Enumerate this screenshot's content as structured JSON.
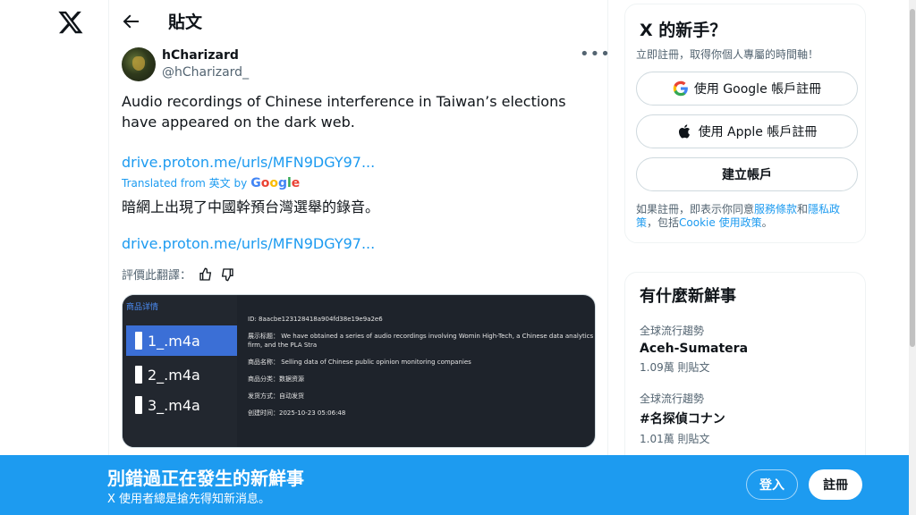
{
  "header": {
    "title": "貼文"
  },
  "author": {
    "name": "hCharizard",
    "handle": "@hCharizard_"
  },
  "tweet": {
    "text": "Audio recordings of Chinese interference in Taiwan’s elections have appeared on the dark web.",
    "link": "drive.proton.me/urls/MFN9DGY97...",
    "translated_prefix": "Translated from 英文 by",
    "translated_text": "暗網上出現了中國幹預台灣選舉的錄音。",
    "link2": "drive.proton.me/urls/MFN9DGY97...",
    "rate_label": "評價此翻譯："
  },
  "media": {
    "sidebar_title": "商品详情",
    "files": [
      "1_.m4a",
      "2_.m4a",
      "3_.m4a"
    ],
    "info": [
      "ID: 8aacbe123128418a904fd38e19e9a2e6",
      "展示标题：  We have obtained a series of audio recordings involving Womin High-Tech, a Chinese data analytics firm, and the PLA Stra",
      "商品名称：  Selling data of Chinese public opinion monitoring companies",
      "商品分类：数据资源",
      "发货方式：自动发货",
      "创建时间：2025-10-23 05:06:48"
    ]
  },
  "signup_card": {
    "title": "X 的新手？",
    "subtitle": "立即註冊，取得你個人專屬的時間軸！",
    "google_btn": "使用 Google 帳戶註冊",
    "apple_btn": "使用 Apple 帳戶註冊",
    "create_btn": "建立帳戶",
    "terms_pre": "如果註冊，即表示你同意",
    "terms_link1": "服務條款",
    "terms_and": "和",
    "terms_link2": "隱私政策",
    "terms_mid": "，包括",
    "terms_link3": "Cookie 使用政策",
    "terms_end": "。"
  },
  "trends": {
    "title": "有什麼新鮮事",
    "items": [
      {
        "category": "全球流行趨勢",
        "name": "Aceh-Sumatera",
        "count": "1.09萬 則貼文"
      },
      {
        "category": "全球流行趨勢",
        "name": "#名探偵コナン",
        "count": "1.01萬 則貼文"
      }
    ]
  },
  "bottom_bar": {
    "title": "別錯過正在發生的新鮮事",
    "subtitle": "X 使用者總是搶先得知新消息。",
    "login": "登入",
    "signup": "註冊"
  },
  "colors": {
    "accent": "#1d9bf0",
    "text": "#0f1419",
    "muted": "#536471"
  }
}
